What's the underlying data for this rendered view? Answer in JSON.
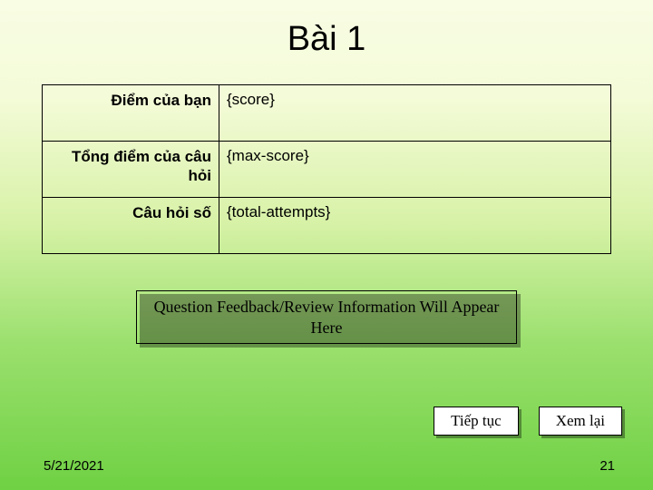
{
  "title": "Bài 1",
  "rows": [
    {
      "label": "Điểm của bạn",
      "value": "{score}"
    },
    {
      "label": "Tổng điểm của câu hỏi",
      "value": "{max-score}"
    },
    {
      "label": "Câu hỏi số",
      "value": "{total-attempts}"
    }
  ],
  "feedback": "Question Feedback/Review Information Will Appear Here",
  "buttons": {
    "continue": "Tiếp tục",
    "review": "Xem lại"
  },
  "footer": {
    "date": "5/21/2021",
    "page": "21"
  }
}
